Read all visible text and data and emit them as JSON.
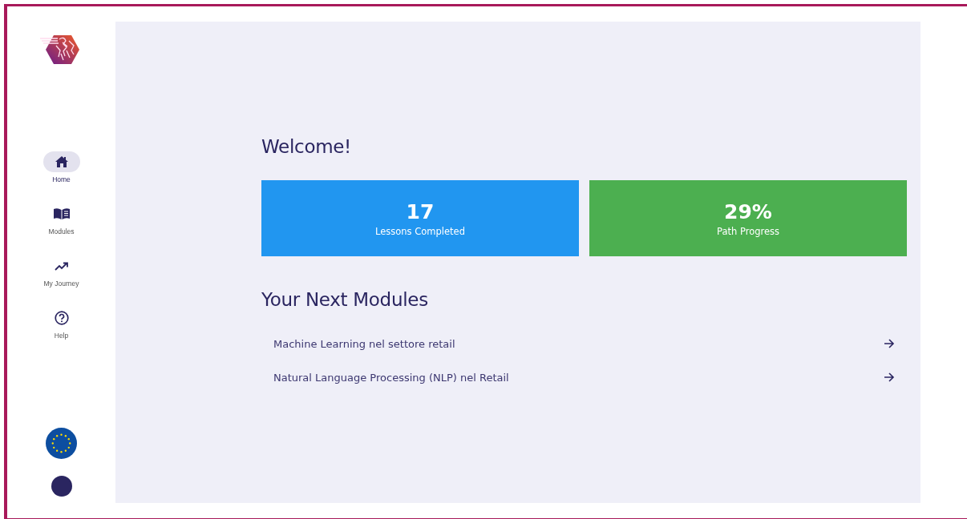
{
  "sidebar": {
    "items": [
      {
        "label": "Home",
        "kind": "home",
        "selected": true
      },
      {
        "label": "Modules",
        "kind": "book",
        "selected": false
      },
      {
        "label": "My Journey",
        "kind": "trend",
        "selected": false
      },
      {
        "label": "Help",
        "kind": "help",
        "selected": false
      }
    ]
  },
  "welcome": {
    "title": "Welcome!"
  },
  "stats": [
    {
      "value": "17",
      "label": "Lessons Completed",
      "color": "#2196f0"
    },
    {
      "value": "29%",
      "label": "Path Progress",
      "color": "#4caf50"
    }
  ],
  "next_modules": {
    "title": "Your Next Modules",
    "items": [
      {
        "title": "Machine Learning nel settore retail"
      },
      {
        "title": "Natural Language Processing (NLP) nel Retail"
      }
    ]
  }
}
